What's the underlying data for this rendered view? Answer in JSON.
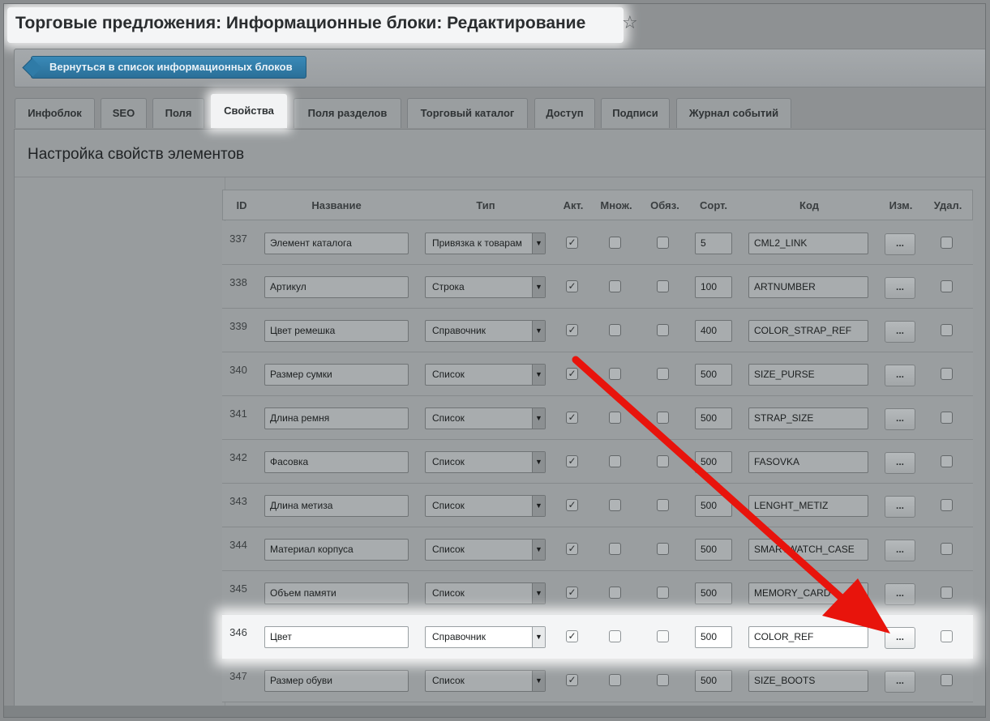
{
  "page": {
    "title": "Торговые предложения: Информационные блоки: Редактирование",
    "star_icon": "☆"
  },
  "toolbar": {
    "back_label": "Вернуться в список информационных блоков"
  },
  "tabs": [
    {
      "label": "Инфоблок",
      "active": false
    },
    {
      "label": "SEO",
      "active": false
    },
    {
      "label": "Поля",
      "active": false
    },
    {
      "label": "Свойства",
      "active": true
    },
    {
      "label": "Поля разделов",
      "active": false
    },
    {
      "label": "Торговый каталог",
      "active": false
    },
    {
      "label": "Доступ",
      "active": false
    },
    {
      "label": "Подписи",
      "active": false
    },
    {
      "label": "Журнал событий",
      "active": false
    }
  ],
  "section": {
    "title": "Настройка свойств элементов"
  },
  "table": {
    "headers": {
      "id": "ID",
      "name": "Название",
      "type": "Тип",
      "active": "Акт.",
      "multiple": "Множ.",
      "required": "Обяз.",
      "sort": "Сорт.",
      "code": "Код",
      "edit": "Изм.",
      "delete": "Удал."
    },
    "edit_button_label": "...",
    "rows": [
      {
        "id": "337",
        "name": "Элемент каталога",
        "type": "Привязка к товарам",
        "active": true,
        "multiple": false,
        "required": false,
        "sort": "5",
        "code": "CML2_LINK"
      },
      {
        "id": "338",
        "name": "Артикул",
        "type": "Строка",
        "active": true,
        "multiple": false,
        "required": false,
        "sort": "100",
        "code": "ARTNUMBER"
      },
      {
        "id": "339",
        "name": "Цвет ремешка",
        "type": "Справочник",
        "active": true,
        "multiple": false,
        "required": false,
        "sort": "400",
        "code": "COLOR_STRAP_REF"
      },
      {
        "id": "340",
        "name": "Размер сумки",
        "type": "Список",
        "active": true,
        "multiple": false,
        "required": false,
        "sort": "500",
        "code": "SIZE_PURSE"
      },
      {
        "id": "341",
        "name": "Длина ремня",
        "type": "Список",
        "active": true,
        "multiple": false,
        "required": false,
        "sort": "500",
        "code": "STRAP_SIZE"
      },
      {
        "id": "342",
        "name": "Фасовка",
        "type": "Список",
        "active": true,
        "multiple": false,
        "required": false,
        "sort": "500",
        "code": "FASOVKA"
      },
      {
        "id": "343",
        "name": "Длина метиза",
        "type": "Список",
        "active": true,
        "multiple": false,
        "required": false,
        "sort": "500",
        "code": "LENGHT_METIZ"
      },
      {
        "id": "344",
        "name": "Материал корпуса",
        "type": "Список",
        "active": true,
        "multiple": false,
        "required": false,
        "sort": "500",
        "code": "SMARTWATCH_CASE"
      },
      {
        "id": "345",
        "name": "Объем памяти",
        "type": "Список",
        "active": true,
        "multiple": false,
        "required": false,
        "sort": "500",
        "code": "MEMORY_CARD"
      },
      {
        "id": "346",
        "name": "Цвет",
        "type": "Справочник",
        "active": true,
        "multiple": false,
        "required": false,
        "sort": "500",
        "code": "COLOR_REF",
        "highlighted": true
      },
      {
        "id": "347",
        "name": "Размер обуви",
        "type": "Список",
        "active": true,
        "multiple": false,
        "required": false,
        "sort": "500",
        "code": "SIZE_BOOTS"
      }
    ]
  },
  "annotation": {
    "arrow_color": "#e8140c"
  }
}
